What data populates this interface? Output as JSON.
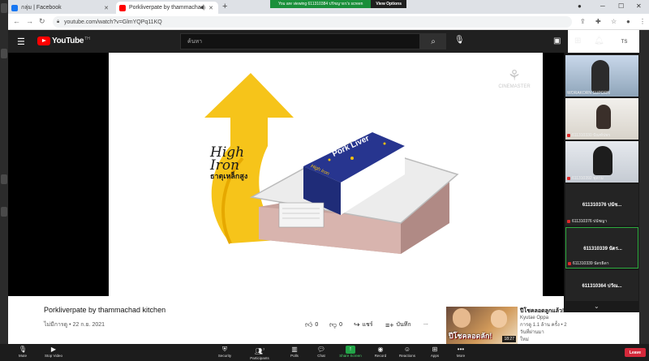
{
  "browser": {
    "tabs": [
      {
        "label": "กลุ่ม | Facebook",
        "active": false,
        "icon": "facebook-icon",
        "color": "#1877f2"
      },
      {
        "label": "Porkliverpate by thammachad",
        "active": true,
        "icon": "youtube-icon",
        "color": "#ff0000"
      }
    ],
    "url": "youtube.com/watch?v=GlmYQPq11KQ"
  },
  "zoom_banner": {
    "text": "You are viewing 611310384 ปรัชญาธร's screen",
    "view_options": "View Options"
  },
  "youtube": {
    "logo_text": "YouTube",
    "country_code": "TH",
    "search_placeholder": "ค้นหา",
    "avatar_initials": "TS",
    "accent": "#ff0000"
  },
  "video_frame": {
    "watermark": "CINEMASTER",
    "arrow_text_line1": "High",
    "arrow_text_line2": "Iron",
    "arrow_text_line3": "ธาตุเหล็กสูง",
    "product_brand": "Pork Liver",
    "product_sub": "High Iron"
  },
  "video_info": {
    "title": "Porkliverpate by thammachad kitchen",
    "meta": "ไม่มีการดู • 22 ก.ย. 2021",
    "likes": "0",
    "dislikes": "0",
    "share_label": "แชร์",
    "save_label": "บันทึก",
    "more_label": "..."
  },
  "recommended": {
    "thumb_text": "ปีโชคลอดลัก!",
    "duration": "18:27",
    "title": "ปีโชคลอดลูกแล้ว!",
    "channel": "Kyutae Oppa",
    "views": "การดู 1.1 ล้าน ครั้ง • 2 วันที่ผ่านมา",
    "badge": "ใหม่"
  },
  "participants": [
    {
      "label": "WORAKORN SUPORN",
      "kind": "video",
      "active": false
    },
    {
      "label": "611310330 ปัณฑ์ปพร",
      "kind": "video",
      "active": false
    },
    {
      "label": "611310392 ชุดาม",
      "kind": "video",
      "active": false
    },
    {
      "label": "611310376 ปนัชญา",
      "big": "611310376 ปนัช...",
      "kind": "name",
      "active": false
    },
    {
      "label": "611310339 นัดรธิดา",
      "big": "611310339 นัดร...",
      "kind": "name",
      "active": true
    },
    {
      "label": "",
      "big": "611310364 ปวัณ...",
      "kind": "name",
      "active": false
    }
  ],
  "zoom_toolbar": [
    {
      "label": "Mute",
      "icon": "microphone-icon"
    },
    {
      "label": "Stop Video",
      "icon": "video-camera-icon"
    },
    {
      "label": "Security",
      "icon": "shield-icon"
    },
    {
      "label": "Participants",
      "icon": "participants-icon",
      "count": "7"
    },
    {
      "label": "Polls",
      "icon": "polls-icon"
    },
    {
      "label": "Chat",
      "icon": "chat-icon"
    },
    {
      "label": "Share Screen",
      "icon": "share-screen-icon"
    },
    {
      "label": "Record",
      "icon": "record-icon"
    },
    {
      "label": "Reactions",
      "icon": "reactions-icon"
    },
    {
      "label": "Apps",
      "icon": "apps-icon"
    },
    {
      "label": "More",
      "icon": "more-icon"
    }
  ],
  "leave_label": "Leave",
  "colors": {
    "zoom_green": "#22a447",
    "leave_red": "#d4283a",
    "arrow_yellow": "#f5c10e",
    "package_blue": "#27358f"
  }
}
